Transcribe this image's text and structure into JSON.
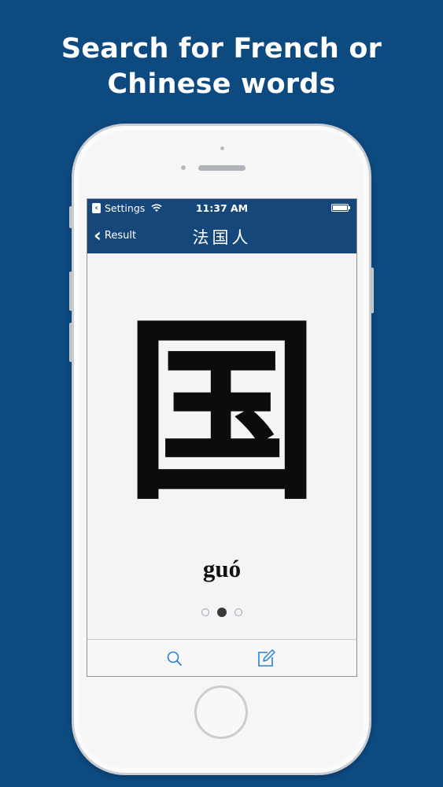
{
  "headline": {
    "line1": "Search for French or",
    "line2": "Chinese words"
  },
  "status_bar": {
    "back_app": "Settings",
    "time": "11:37 AM"
  },
  "nav_bar": {
    "back_label": "Result",
    "title": "法国人"
  },
  "detail": {
    "character": "国",
    "pinyin": "guó",
    "page_index": 1,
    "page_count": 3
  },
  "toolbar": {
    "search_icon": "search-icon",
    "edit_icon": "compose-icon"
  },
  "colors": {
    "background": "#0d4a80",
    "nav": "#15477a",
    "accent": "#2a7fd4"
  }
}
